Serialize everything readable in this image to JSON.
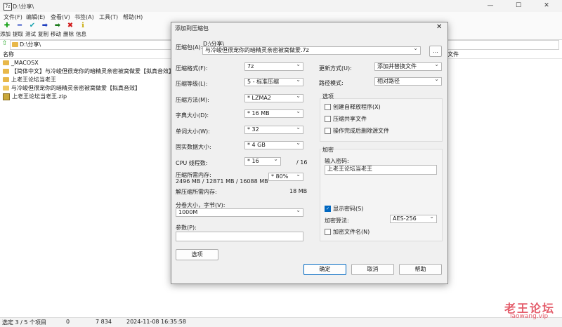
{
  "window": {
    "title": "D:\\分享\\",
    "controls": [
      "—",
      "☐",
      "✕"
    ]
  },
  "menu": [
    "文件(F)",
    "编辑(E)",
    "查看(V)",
    "书签(A)",
    "工具(T)",
    "帮助(H)"
  ],
  "toolbar": [
    {
      "icon": "✚",
      "label": "添加",
      "color": "#1aa31a"
    },
    {
      "icon": "━",
      "label": "提取",
      "color": "#1f3fbf"
    },
    {
      "icon": "✔",
      "label": "测试",
      "color": "#1aa3b0"
    },
    {
      "icon": "➡",
      "label": "复制",
      "color": "#1f3fbf"
    },
    {
      "icon": "➡",
      "label": "移动",
      "color": "#1a7a1a"
    },
    {
      "icon": "✖",
      "label": "删除",
      "color": "#d11a1a"
    },
    {
      "icon": "ℹ",
      "label": "信息",
      "color": "#c7a800"
    }
  ],
  "address": "D:\\分享\\",
  "columns": {
    "name": "名称",
    "right": "文件"
  },
  "files": [
    {
      "name": "_MACOSX",
      "type": "folder"
    },
    {
      "name": "【简体中文】与冷峻但很宠你的暗精灵亲密被窝做爱【拟真音效】",
      "type": "folder"
    },
    {
      "name": "上老王论坛当老王",
      "type": "folder"
    },
    {
      "name": "与冷峻但很宠你的暗精灵亲密被窝做爱【拟真音效】",
      "type": "folder-open"
    },
    {
      "name": "上老王论坛当老王.zip",
      "type": "zip"
    }
  ],
  "status": {
    "selection": "选定 3 / 5 个项目",
    "count": "0",
    "size": "7 834",
    "date": "2024-11-08 16:35:58"
  },
  "watermark": {
    "cn": "老王论坛",
    "url": "laowang.vip"
  },
  "dialog": {
    "title": "添加到压缩包",
    "archive_label": "压缩包(A):",
    "archive_path": "D:\\分享\\",
    "archive_name": "与冷峻但很宠你的暗精灵亲密被窝做爱.7z",
    "browse": "...",
    "format_label": "压缩格式(F):",
    "format_value": "7z",
    "level_label": "压缩等级(L):",
    "level_value": "5 - 标准压缩",
    "method_label": "压缩方法(M):",
    "method_value": "* LZMA2",
    "dict_label": "字典大小(D):",
    "dict_value": "* 16 MB",
    "word_label": "单词大小(W):",
    "word_value": "* 32",
    "solid_label": "固实数据大小:",
    "solid_value": "* 4 GB",
    "cpu_label": "CPU 线程数:",
    "cpu_value": "* 16",
    "cpu_total": "/ 16",
    "mem_label": "压缩所需内存:",
    "mem_value": "2496 MB / 12871 MB / 16088 MB",
    "mem_pct": "* 80%",
    "decomp_label": "解压缩所需内存:",
    "decomp_value": "18 MB",
    "split_label": "分卷大小，字节(V):",
    "split_value": "1000M",
    "params_label": "参数(P):",
    "params_value": "",
    "options_btn": "选项",
    "update_label": "更新方式(U):",
    "update_value": "添加并替换文件",
    "path_label": "路径模式:",
    "path_value": "相对路径",
    "options_group": "选项",
    "opt_sfx": "创建自释放程序(X)",
    "opt_shared": "压缩共享文件",
    "opt_delete": "操作完成后删除源文件",
    "enc_group": "加密",
    "pwd_label": "输入密码:",
    "pwd_value": "上老王论坛当老王",
    "show_pwd": "显示密码(S)",
    "enc_method_label": "加密算法:",
    "enc_method_value": "AES-256",
    "enc_names": "加密文件名(N)",
    "ok": "确定",
    "cancel": "取消",
    "help": "帮助"
  }
}
